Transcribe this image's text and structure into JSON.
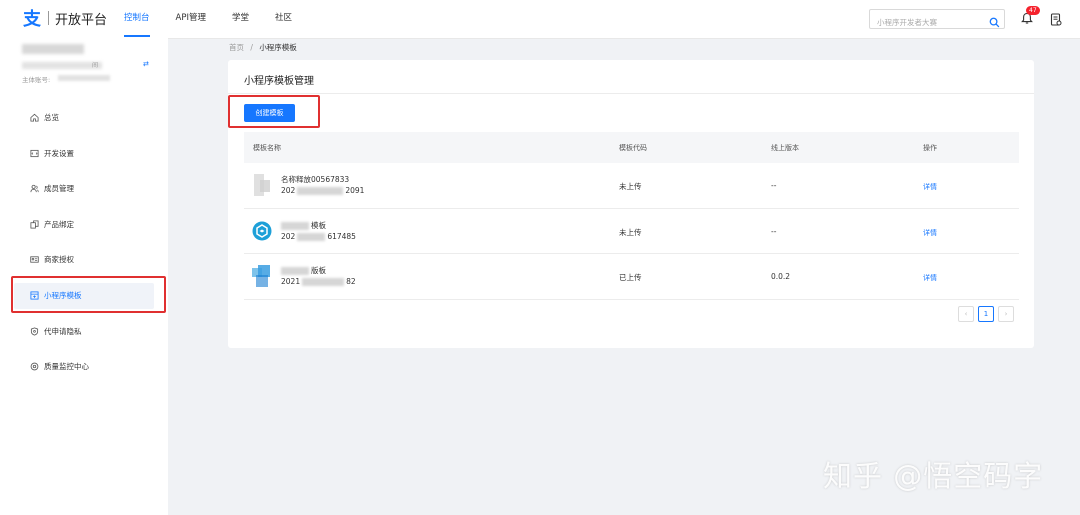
{
  "brand": {
    "mark": "支",
    "name": "开放平台"
  },
  "nav": [
    {
      "label": "控制台",
      "active": true
    },
    {
      "label": "API管理",
      "active": false
    },
    {
      "label": "学堂",
      "active": false
    },
    {
      "label": "社区",
      "active": false
    }
  ],
  "search": {
    "placeholder": "小程序开发者大赛"
  },
  "notifications": {
    "count": "47"
  },
  "account": {
    "suffix": "间",
    "subject_label": "主体账号:"
  },
  "sidebar": {
    "items": [
      {
        "label": "总览",
        "icon": "home-icon"
      },
      {
        "label": "开发设置",
        "icon": "code-icon"
      },
      {
        "label": "成员管理",
        "icon": "users-icon"
      },
      {
        "label": "产品绑定",
        "icon": "link-icon"
      },
      {
        "label": "商家授权",
        "icon": "id-card-icon"
      },
      {
        "label": "小程序模板",
        "icon": "template-icon",
        "active": true
      },
      {
        "label": "代申请隐私",
        "icon": "shield-icon"
      },
      {
        "label": "质量监控中心",
        "icon": "gear-icon"
      }
    ]
  },
  "breadcrumb": {
    "home": "首页",
    "separator": "/",
    "current": "小程序模板"
  },
  "card": {
    "title": "小程序模板管理",
    "create_label": "创建模板"
  },
  "table": {
    "headers": [
      "模板名称",
      "模板代码",
      "线上版本",
      "操作"
    ],
    "rows": [
      {
        "name": "名称释放00567833",
        "code_prefix": "202",
        "code_suffix": "2091",
        "status": "未上传",
        "version": "--",
        "action": "详情"
      },
      {
        "name": "模板",
        "code_prefix": "202",
        "code_suffix": "617485",
        "status": "未上传",
        "version": "--",
        "action": "详情"
      },
      {
        "name": "版板",
        "code_prefix": "2021",
        "code_suffix": "82",
        "status": "已上传",
        "version": "0.0.2",
        "action": "详情"
      }
    ]
  },
  "pagination": {
    "prev": "‹",
    "page": "1",
    "next": "›"
  },
  "watermark": "知乎 @悟空码字",
  "colors": {
    "accent": "#1677ff",
    "highlight": "#e03030"
  }
}
